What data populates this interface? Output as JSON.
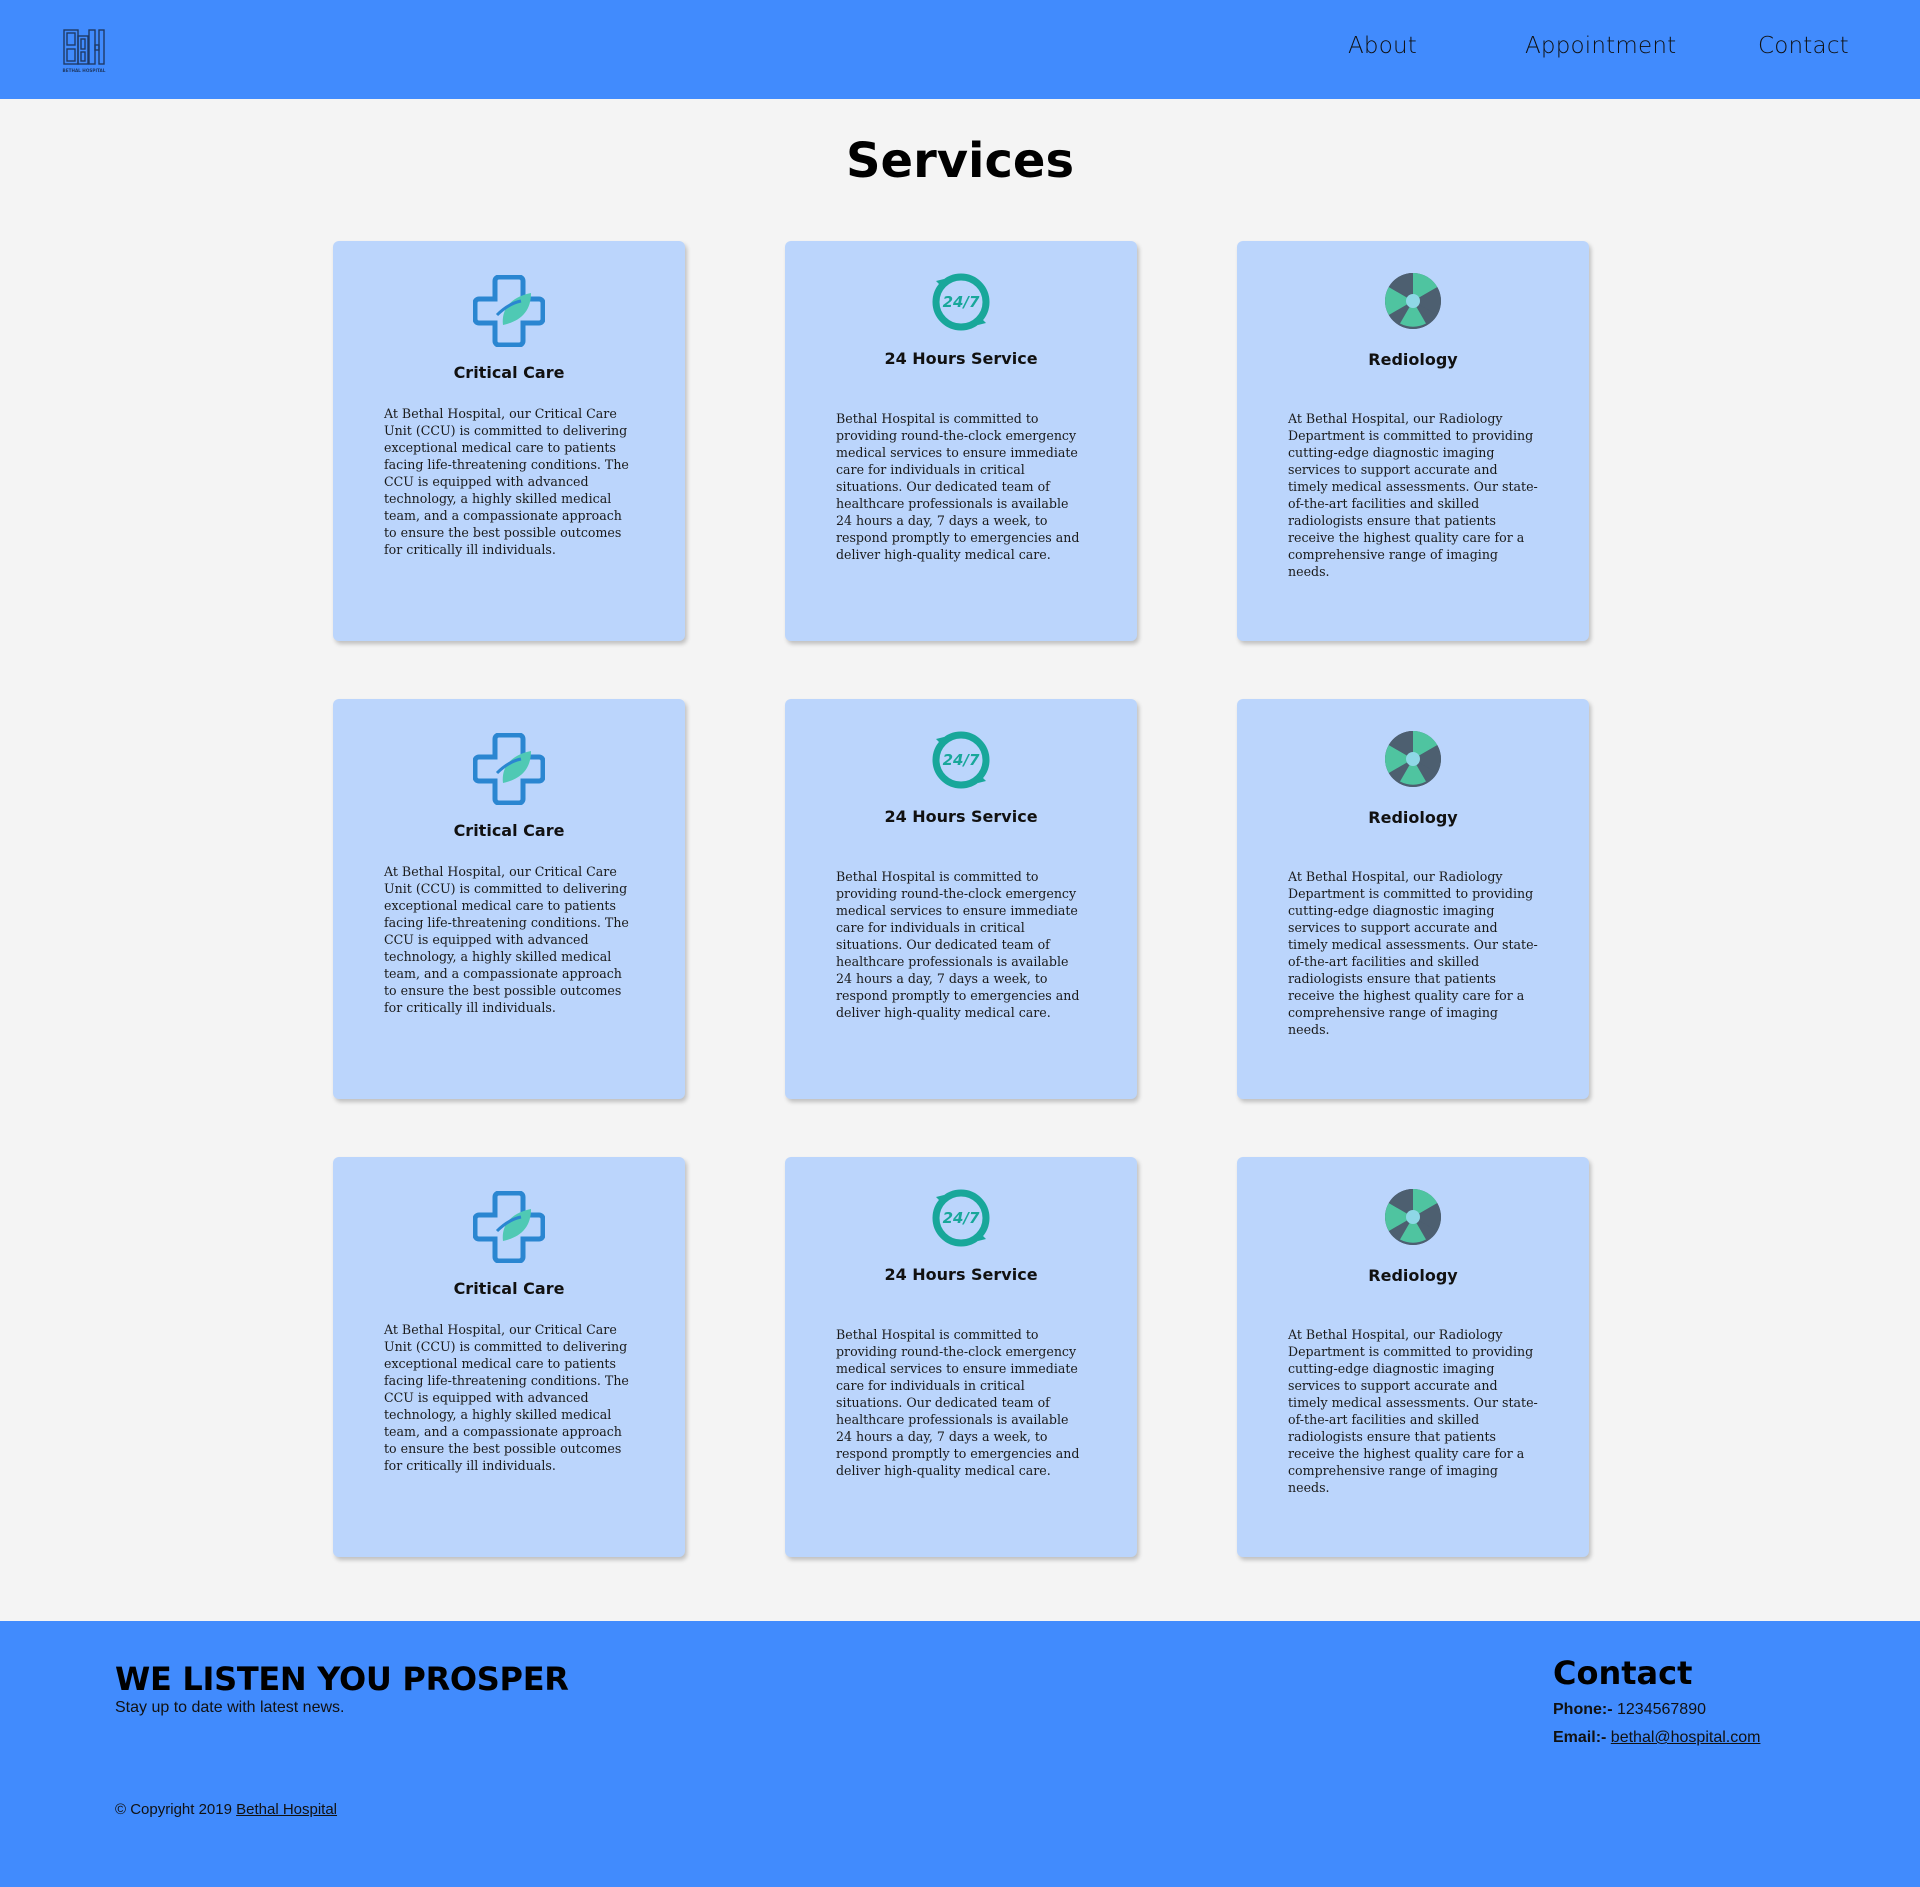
{
  "header": {
    "logo_icon": "bethal-hospital-logo",
    "logo_text": "BETHAL HOSPITAL",
    "nav": [
      {
        "label": "About"
      },
      {
        "label": "Appointment"
      },
      {
        "label": "Contact"
      }
    ],
    "background_color": "#418bfd"
  },
  "main": {
    "title": "Services",
    "card_color": "#bbd5fc",
    "services": [
      {
        "icon": "medical-cross-leaf-icon",
        "title": "Critical Care",
        "text": "At Bethal Hospital, our Critical Care Unit (CCU) is committed to delivering exceptional medical care to patients facing life-threatening conditions. The CCU is equipped with advanced technology, a highly skilled medical team, and a compassionate approach to ensure the best possible outcomes for critically ill individuals."
      },
      {
        "icon": "clock-24-7-icon",
        "title": "24 Hours Service",
        "text": "Bethal Hospital is committed to providing round-the-clock emergency medical services to ensure immediate care for individuals in critical situations. Our dedicated team of healthcare professionals is available 24 hours a day, 7 days a week, to respond promptly to emergencies and deliver high-quality medical care."
      },
      {
        "icon": "radiation-icon",
        "title": "Rediology",
        "text": "At Bethal Hospital, our Radiology Department is committed to providing cutting-edge diagnostic imaging services to support accurate and timely medical assessments. Our state-of-the-art facilities and skilled radiologists ensure that patients receive the highest quality care for a comprehensive range of imaging needs."
      }
    ]
  },
  "footer": {
    "slogan": "WE LISTEN YOU PROSPER",
    "subtext": "Stay up to date with latest news.",
    "contact_title": "Contact",
    "phone_label": "Phone:-",
    "phone": "1234567890",
    "email_label": "Email:-",
    "email": "bethal@hospital.com",
    "copyright_prefix": "© Copyright 2019",
    "copyright_link": "Bethal Hospital"
  }
}
